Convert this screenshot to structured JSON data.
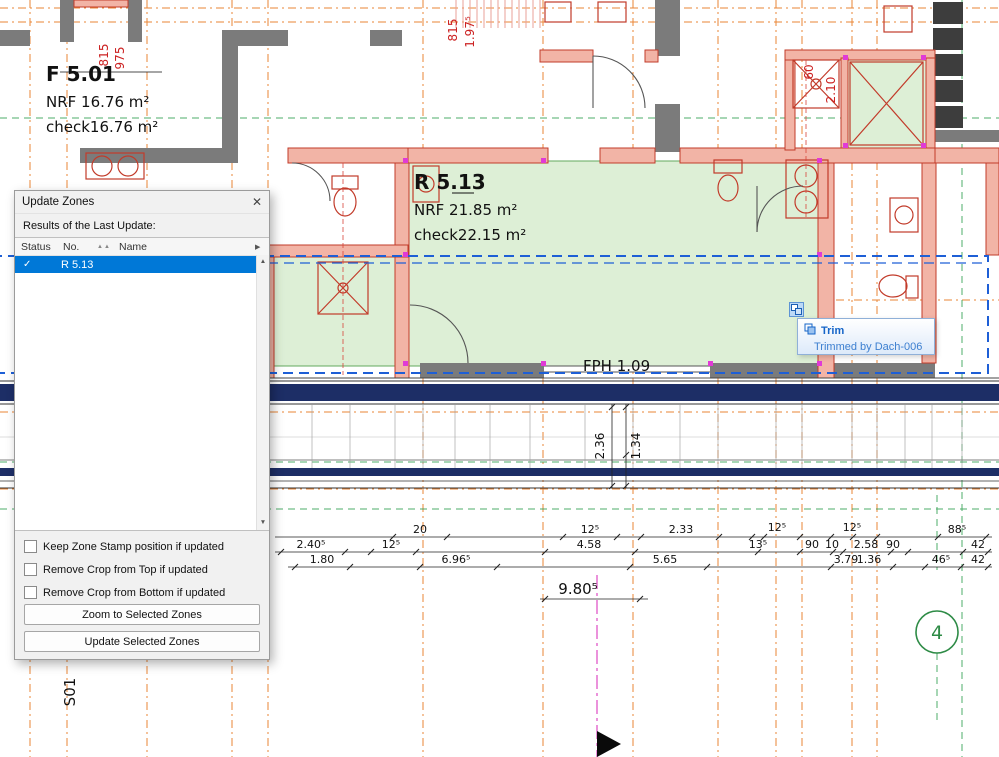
{
  "dialog": {
    "title": "Update Zones",
    "results_label": "Results of the Last Update:",
    "columns": {
      "status": "Status",
      "no": "No.",
      "name": "Name"
    },
    "icons": {
      "close": "✕",
      "sort_pair": "▲▲",
      "more": "▶",
      "up": "▲",
      "down": "▼"
    },
    "rows": [
      {
        "status": "✓",
        "name": "R 5.13",
        "selected": true
      }
    ],
    "checkboxes": [
      {
        "label": "Keep Zone Stamp position if updated",
        "checked": false
      },
      {
        "label": "Remove Crop from Top if updated",
        "checked": false
      },
      {
        "label": "Remove Crop from Bottom if updated",
        "checked": false
      }
    ],
    "buttons": {
      "zoom": "Zoom to Selected Zones",
      "update": "Update Selected Zones"
    }
  },
  "plan": {
    "stamps": {
      "f501": {
        "name": "F 5.01",
        "nrf": "NRF 16.76 m²",
        "check": "check16.76 m²"
      },
      "r513": {
        "name": "R 5.13",
        "nrf": "NRF 21.85 m²",
        "check": "check22.15 m²"
      }
    },
    "labels": {
      "fph": "FPH 1.09",
      "section": "S01",
      "grid_bubble": "4"
    },
    "tooltip": {
      "title": "Trim",
      "body": "Trimmed by Dach-006"
    },
    "dims": {
      "r1": [
        "20",
        "12⁵",
        "2.33",
        "12⁵",
        "12⁵",
        "88⁵"
      ],
      "r2": [
        "2.40⁵",
        "12⁵",
        "4.58",
        "13⁵",
        "90",
        "10",
        "2.58",
        "90",
        "42"
      ],
      "r3": [
        "1.80",
        "6.96⁵",
        "5.65",
        "3.79",
        "1.36",
        "46⁵",
        "42"
      ],
      "total": "9.80⁵",
      "vert": [
        "2.36",
        "1.34"
      ],
      "red": [
        "815",
        "975",
        "815",
        "1.97⁵",
        "60",
        "2.10"
      ]
    },
    "colors": {
      "grid_orange": "#e87820",
      "grid_green": "#2e9e4f",
      "wall_red": "#c23b2a",
      "wall_red_fill": "#f2b4a6",
      "wall_gray": "#7b7b7b",
      "zone_fill": "#ddefd6",
      "selection_blue": "#1e5fd6",
      "slab_navy": "#1d2e66",
      "handle_magenta": "#e03ad6",
      "selected_row_blue": "#0078d7"
    }
  }
}
